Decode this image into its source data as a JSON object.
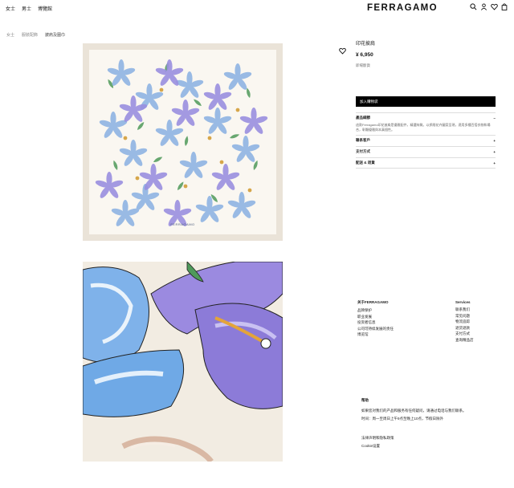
{
  "header": {
    "nav": [
      "女士",
      "男士",
      "博覽館"
    ],
    "logo": "FERRAGAMO",
    "icons": [
      "search-icon",
      "account-icon",
      "wishlist-icon",
      "bag-icon"
    ]
  },
  "breadcrumb": [
    "女士",
    "服裝配飾",
    "披肩及圍巾"
  ],
  "product": {
    "name": "印花披肩",
    "price": "¥ 6,950",
    "stock_label": "即場斷貨",
    "image_brand_mark": "FERRAGAMO",
    "add_to_cart": "加入購物袋",
    "sections": [
      {
        "label": "產品細節",
        "toggle": "−",
        "description": "這款Ferragamo印花披肩是優雅配件，精選絲質。以抓眼花卉圖案呈現，適用多種百搭衣物和場合，彰顯優雅與本真個性。"
      },
      {
        "label": "聯系客戶",
        "toggle": "+"
      },
      {
        "label": "支付方式",
        "toggle": "+"
      },
      {
        "label": "配送 & 退貨",
        "toggle": "+"
      }
    ]
  },
  "footer": {
    "about": {
      "title": "关于FERRAGAMO",
      "links": [
        "品牌保护",
        "职业发展",
        "投资者信息",
        "公司可持续发展的责任",
        "博览馆"
      ]
    },
    "services": {
      "title": "Services",
      "links": [
        "联系我们",
        "常见问题",
        "物流追踪",
        "退货退款",
        "支付方式",
        "查询精品店"
      ]
    },
    "help": {
      "title": "帮助",
      "text1": "如果您对我们的产品和服务有任何疑问，请通过电话与我们联系。",
      "text2": "时间：周一至周日上午9点至晚上10点，节假日除外"
    },
    "legal": [
      "法律声明和隐私政策",
      "Cookie设置"
    ]
  },
  "colors": {
    "accent": "#000000",
    "petal_blue": "#8fb4e3",
    "petal_violet": "#9a8fe0",
    "leaf_green": "#4f9a5a",
    "scarf_bg": "#faf7f1"
  }
}
